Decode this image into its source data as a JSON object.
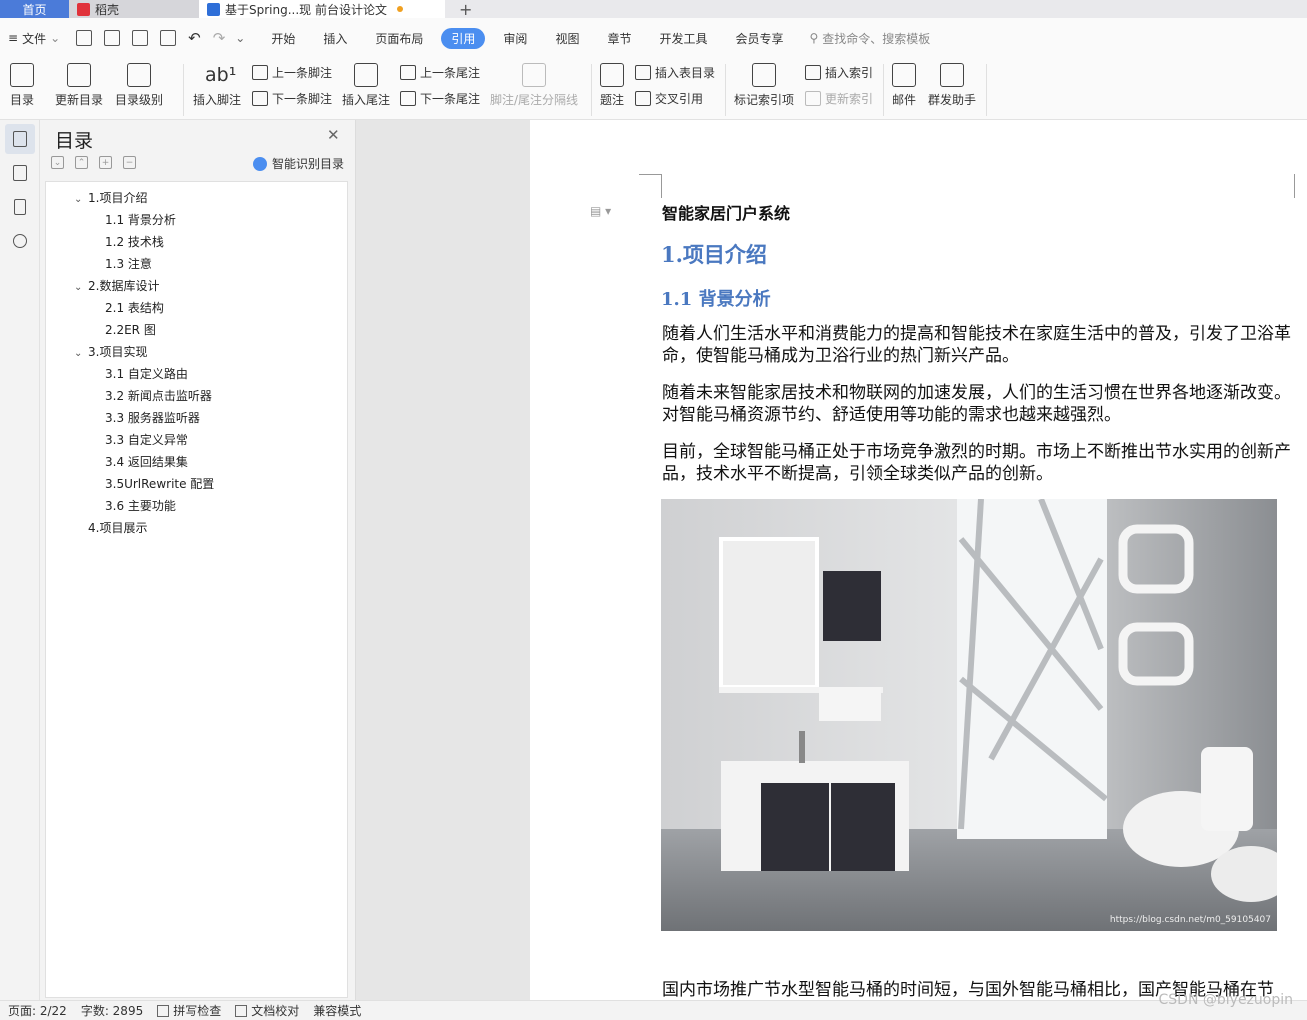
{
  "tabs": {
    "home": "首页",
    "daoke": "稻壳",
    "doc": "基于Spring...现 前台设计论文",
    "plus": "+"
  },
  "menu": {
    "file": "文件",
    "ribbon_tabs": [
      "开始",
      "插入",
      "页面布局",
      "引用",
      "审阅",
      "视图",
      "章节",
      "开发工具",
      "会员专享"
    ],
    "active_tab": "引用",
    "search_placeholder": "查找命令、搜索模板"
  },
  "ribbon": {
    "toc": "目录",
    "update_toc": "更新目录",
    "toc_level": "目录级别",
    "insert_footnote": "插入脚注",
    "prev_footnote": "上一条脚注",
    "next_footnote": "下一条脚注",
    "insert_endnote": "插入尾注",
    "prev_endnote": "上一条尾注",
    "next_endnote": "下一条尾注",
    "separator": "脚注/尾注分隔线",
    "caption": "题注",
    "insert_table_toc": "插入表目录",
    "cross_ref": "交叉引用",
    "mark_index": "标记索引项",
    "insert_index": "插入索引",
    "update_index": "更新索引",
    "mail": "邮件",
    "mass_send": "群发助手"
  },
  "toc_panel": {
    "title": "目录",
    "smart": "智能识别目录",
    "items": [
      {
        "label": "1.项目介绍",
        "level": 1,
        "expand": true
      },
      {
        "label": "1.1 背景分析",
        "level": 2
      },
      {
        "label": "1.2 技术栈",
        "level": 2
      },
      {
        "label": "1.3 注意",
        "level": 2
      },
      {
        "label": "2.数据库设计",
        "level": 1,
        "expand": true
      },
      {
        "label": "2.1 表结构",
        "level": 2
      },
      {
        "label": "2.2ER 图",
        "level": 2
      },
      {
        "label": "3.项目实现",
        "level": 1,
        "expand": true
      },
      {
        "label": "3.1 自定义路由",
        "level": 2
      },
      {
        "label": "3.2 新闻点击监听器",
        "level": 2
      },
      {
        "label": "3.3 服务器监听器",
        "level": 2
      },
      {
        "label": "3.3 自定义异常",
        "level": 2
      },
      {
        "label": "3.4 返回结果集",
        "level": 2
      },
      {
        "label": "3.5UrlRewrite 配置",
        "level": 2
      },
      {
        "label": "3.6 主要功能",
        "level": 2
      },
      {
        "label": "4.项目展示",
        "level": 1
      }
    ]
  },
  "document": {
    "title": "智能家居门户系统",
    "h1": "1.项目介绍",
    "h2": "1.1 背景分析",
    "paragraphs": [
      "随着人们生活水平和消费能力的提高和智能技术在家庭生活中的普及，引发了卫浴革命，使智能马桶成为卫浴行业的热门新兴产品。",
      "随着未来智能家居技术和物联网的加速发展，人们的生活习惯在世界各地逐渐改变。对智能马桶资源节约、舒适使用等功能的需求也越来越强烈。",
      "目前，全球智能马桶正处于市场竞争激烈的时期。市场上不断推出节水实用的创新产品，技术水平不断提高，引领全球类似产品的创新。",
      "国内市场推广节水型智能马桶的时间短，与国外智能马桶相比，国产智能马桶在节"
    ],
    "image_watermark": "https://blog.csdn.net/m0_59105407"
  },
  "status": {
    "page": "页面: 2/22",
    "words": "字数: 2895",
    "spell": "拼写检查",
    "proof": "文档校对",
    "compat": "兼容模式"
  },
  "watermark": "CSDN @biyezuopin"
}
